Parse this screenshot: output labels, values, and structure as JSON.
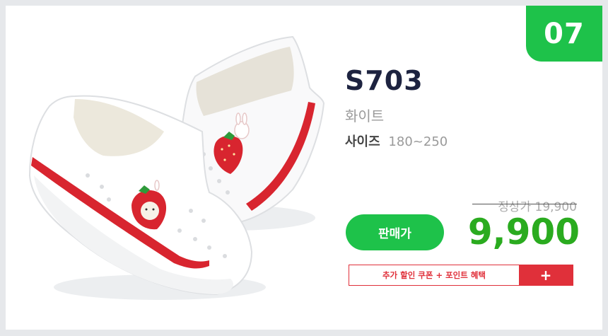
{
  "badge": {
    "number": "07"
  },
  "product": {
    "model": "S703",
    "color": "화이트",
    "size_label": "사이즈",
    "size_value": "180~250"
  },
  "pricing": {
    "regular": "정상가 19,900",
    "sale_button_label": "판매가",
    "sale_price": "9,900"
  },
  "promo": {
    "coupon_text": "추가 할인 쿠폰 + 포인트 혜택",
    "plus_icon": "plus-icon"
  },
  "colors": {
    "accent_green": "#1ec24a",
    "price_green": "#2aab1f",
    "promo_red": "#e0303a",
    "model_navy": "#1d2340"
  }
}
